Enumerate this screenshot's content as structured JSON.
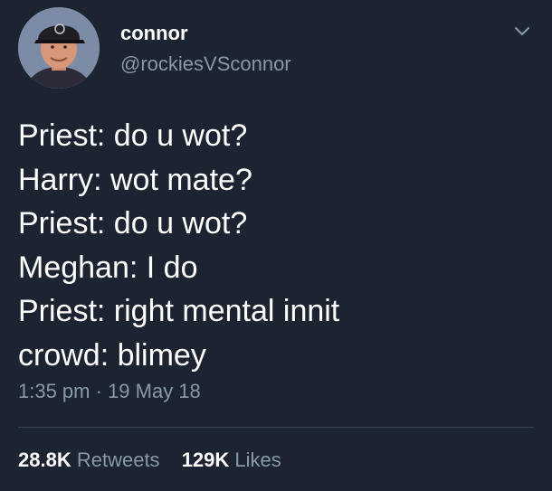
{
  "user": {
    "display_name": "connor",
    "handle": "@rockiesVSconnor",
    "avatar_icon": "profile-photo-icon"
  },
  "menu": {
    "icon": "chevron-down-icon"
  },
  "tweet": {
    "lines": [
      "Priest: do u wot?",
      "Harry: wot mate?",
      "Priest: do u wot?",
      "Meghan: I do",
      "Priest: right mental innit",
      "crowd: blimey"
    ],
    "time": "1:35 pm",
    "separator": " · ",
    "date": "19 May 18"
  },
  "stats": {
    "retweets_count": "28.8K",
    "retweets_label": "Retweets",
    "likes_count": "129K",
    "likes_label": "Likes"
  },
  "colors": {
    "background": "#1b2430",
    "primary_text": "#ffffff",
    "secondary_text": "#8899a6",
    "divider": "#38444d"
  }
}
